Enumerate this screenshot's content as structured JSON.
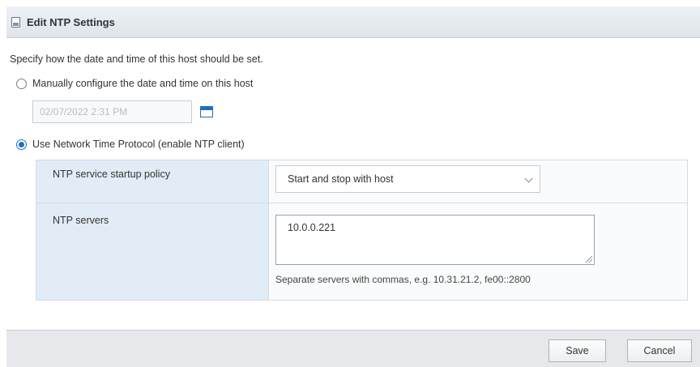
{
  "dialog": {
    "title": "Edit NTP Settings",
    "intro": "Specify how the date and time of this host should be set."
  },
  "manual": {
    "label": "Manually configure the date and time on this host",
    "selected": false,
    "datetime_value": "02/07/2022 2:31 PM"
  },
  "ntp": {
    "label": "Use Network Time Protocol (enable NTP client)",
    "selected": true,
    "startup_policy_label": "NTP service startup policy",
    "startup_policy_value": "Start and stop with host",
    "servers_label": "NTP servers",
    "servers_value": "10.0.0.221",
    "servers_hint": "Separate servers with commas, e.g. 10.31.21.2, fe00::2800"
  },
  "footer": {
    "save_label": "Save",
    "cancel_label": "Cancel"
  },
  "colors": {
    "accent": "#1a73c7",
    "label_bg": "#e1ecf6"
  },
  "icons": [
    "dialog-icon",
    "calendar-icon",
    "chevron-down-icon"
  ]
}
